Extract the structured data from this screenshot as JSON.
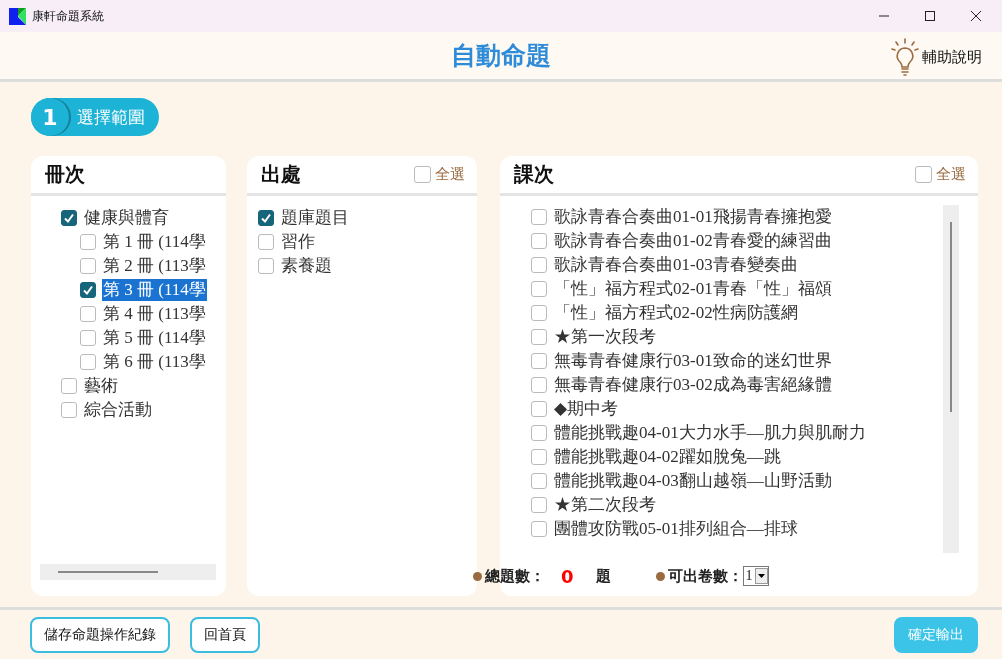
{
  "window": {
    "title": "康軒命題系統"
  },
  "header": {
    "title": "自動命題",
    "help": "輔助說明"
  },
  "step": {
    "number": "1",
    "label": "選擇範圍"
  },
  "books": {
    "title": "冊次",
    "items": [
      {
        "label": "健康與體育",
        "checked": true,
        "selected": false,
        "children": [
          {
            "label": "第 1 冊 (114學",
            "checked": false,
            "selected": false
          },
          {
            "label": "第 2 冊 (113學",
            "checked": false,
            "selected": false
          },
          {
            "label": "第 3 冊 (114學",
            "checked": true,
            "selected": true
          },
          {
            "label": "第 4 冊 (113學",
            "checked": false,
            "selected": false
          },
          {
            "label": "第 5 冊 (114學",
            "checked": false,
            "selected": false
          },
          {
            "label": "第 6 冊 (113學",
            "checked": false,
            "selected": false
          }
        ]
      },
      {
        "label": "藝術",
        "checked": false,
        "selected": false
      },
      {
        "label": "綜合活動",
        "checked": false,
        "selected": false
      }
    ]
  },
  "sources": {
    "title": "出處",
    "select_all": {
      "label": "全選",
      "checked": false
    },
    "items": [
      {
        "label": "題庫題目",
        "checked": true
      },
      {
        "label": "習作",
        "checked": false
      },
      {
        "label": "素養題",
        "checked": false
      }
    ]
  },
  "lessons": {
    "title": "課次",
    "select_all": {
      "label": "全選",
      "checked": false
    },
    "items": [
      {
        "label": "歌詠青春合奏曲01-01飛揚青春擁抱愛",
        "checked": false
      },
      {
        "label": "歌詠青春合奏曲01-02青春愛的練習曲",
        "checked": false
      },
      {
        "label": "歌詠青春合奏曲01-03青春變奏曲",
        "checked": false
      },
      {
        "label": "「性」福方程式02-01青春「性」福頌",
        "checked": false
      },
      {
        "label": "「性」福方程式02-02性病防護網",
        "checked": false
      },
      {
        "label": "★第一次段考",
        "checked": false
      },
      {
        "label": "無毒青春健康行03-01致命的迷幻世界",
        "checked": false
      },
      {
        "label": "無毒青春健康行03-02成為毒害絕緣體",
        "checked": false
      },
      {
        "label": "◆期中考",
        "checked": false
      },
      {
        "label": "體能挑戰趣04-01大力水手—肌力與肌耐力",
        "checked": false
      },
      {
        "label": "體能挑戰趣04-02躍如脫兔—跳",
        "checked": false
      },
      {
        "label": "體能挑戰趣04-03翻山越嶺—山野活動",
        "checked": false
      },
      {
        "label": "★第二次段考",
        "checked": false
      },
      {
        "label": "團體攻防戰05-01排列組合—排球",
        "checked": false
      }
    ]
  },
  "stats": {
    "total_label": "總題數：",
    "total": "0",
    "unit": "題",
    "copies_label": "可出卷數：",
    "copies": "1"
  },
  "buttons": {
    "save": "儲存命題操作紀錄",
    "home": "回首頁",
    "confirm": "確定輸出"
  }
}
